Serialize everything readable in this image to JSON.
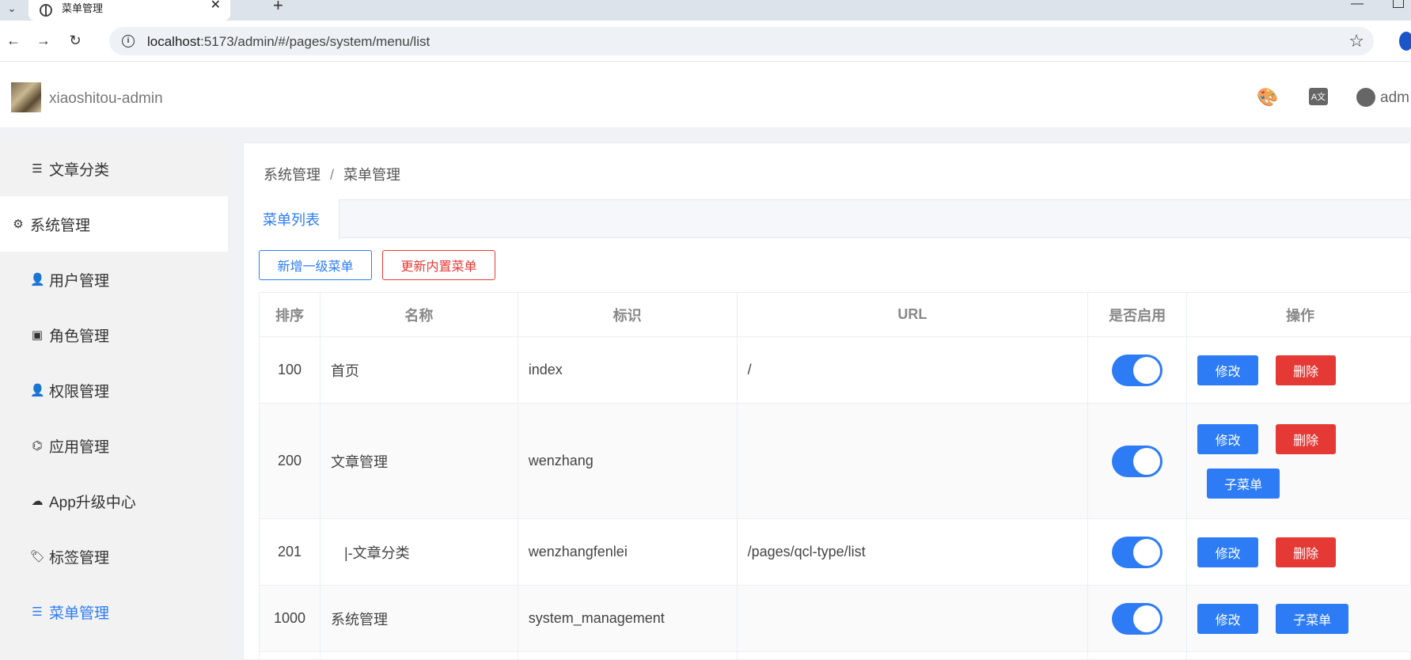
{
  "browser": {
    "tab_title": "菜单管理",
    "url_host": "localhost",
    "url_rest": ":5173/admin/#/pages/system/menu/list"
  },
  "header": {
    "app_title": "xiaoshitou-admin",
    "user_name": "adm"
  },
  "sidebar": {
    "items": [
      {
        "label": "文章分类",
        "icon": "list-icon"
      },
      {
        "label": "系统管理",
        "icon": "gear-icon"
      },
      {
        "label": "用户管理",
        "icon": "user-gear-icon"
      },
      {
        "label": "角色管理",
        "icon": "role-card-icon"
      },
      {
        "label": "权限管理",
        "icon": "user-lock-icon"
      },
      {
        "label": "应用管理",
        "icon": "app-icon"
      },
      {
        "label": "App升级中心",
        "icon": "cloud-upload-icon"
      },
      {
        "label": "标签管理",
        "icon": "tag-icon"
      },
      {
        "label": "菜单管理",
        "icon": "list-icon"
      }
    ]
  },
  "breadcrumb": [
    "系统管理",
    "菜单管理"
  ],
  "tabs": [
    "菜单列表"
  ],
  "toolbar": {
    "add_label": "新增一级菜单",
    "update_label": "更新内置菜单"
  },
  "table": {
    "headers": [
      "排序",
      "名称",
      "标识",
      "URL",
      "是否启用",
      "操作"
    ],
    "rows": [
      {
        "order": "100",
        "name": "首页",
        "key": "index",
        "url": "/",
        "enabled": true
      },
      {
        "order": "200",
        "name": "文章管理",
        "key": "wenzhang",
        "url": "",
        "enabled": true
      },
      {
        "order": "201",
        "name": "|-文章分类",
        "key": "wenzhangfenlei",
        "url": "/pages/qcl-type/list",
        "enabled": true
      },
      {
        "order": "1000",
        "name": "系统管理",
        "key": "system_management",
        "url": "",
        "enabled": true
      }
    ],
    "actions": {
      "edit": "修改",
      "delete": "删除",
      "child": "子菜单"
    }
  },
  "colors": {
    "primary": "#2d7cf6",
    "danger": "#e53935"
  }
}
